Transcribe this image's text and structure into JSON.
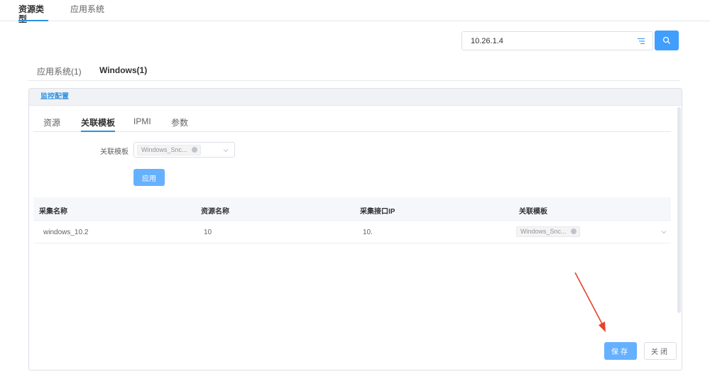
{
  "top_tabs": [
    {
      "label": "资源类型",
      "active": true
    },
    {
      "label": "应用系统",
      "active": false
    }
  ],
  "search": {
    "value": "10.26.1.4",
    "filter_icon": "filter-icon",
    "search_icon": "search-icon"
  },
  "sub_tabs": [
    {
      "label": "应用系统(1)",
      "active": false
    },
    {
      "label": "Windows(1)",
      "active": true
    }
  ],
  "panel": {
    "title": "监控配置",
    "tabs": [
      {
        "label": "资源",
        "active": false
      },
      {
        "label": "关联模板",
        "active": true
      },
      {
        "label": "IPMI",
        "active": false
      },
      {
        "label": "参数",
        "active": false
      }
    ],
    "form": {
      "template_label": "关联模板",
      "template_tag": "Windows_Snc...",
      "apply_label": "应用"
    },
    "table": {
      "columns": [
        "采集名称",
        "资源名称",
        "采集接口IP",
        "关联模板"
      ],
      "rows": [
        {
          "name": "windows_10.2",
          "resource": "10",
          "ip": "10.",
          "template": "Windows_Snc..."
        }
      ]
    }
  },
  "footer": {
    "save_label": "保存",
    "close_label": "关闭"
  },
  "colors": {
    "primary": "#409eff",
    "primary_light": "#66b1ff",
    "annotation_arrow": "#e8412c"
  }
}
